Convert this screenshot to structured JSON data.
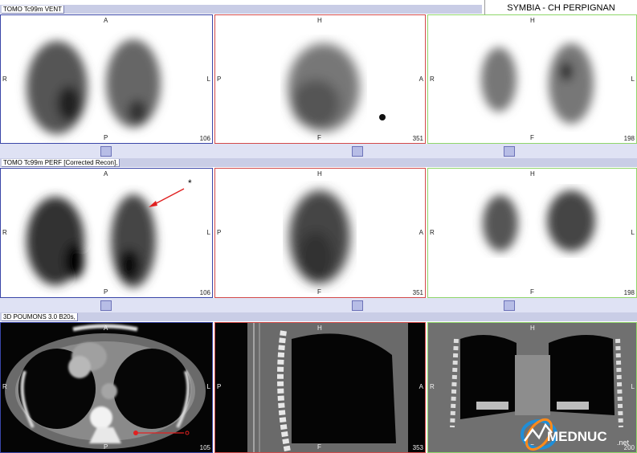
{
  "header_box": {
    "title": "SYMBIA - CH PERPIGNAN"
  },
  "rows": [
    {
      "label": "TOMO Tc99m VENT",
      "panels": [
        {
          "top": "A",
          "bottom": "P",
          "left": "R",
          "right": "L",
          "num": "106"
        },
        {
          "top": "H",
          "bottom": "F",
          "left": "P",
          "right": "A",
          "num": "351"
        },
        {
          "top": "H",
          "bottom": "F",
          "left": "R",
          "right": "L",
          "num": "198"
        }
      ]
    },
    {
      "label": "TOMO Tc99m PERF [Corrected Recon],",
      "panels": [
        {
          "top": "A",
          "bottom": "P",
          "left": "R",
          "right": "L",
          "num": "106"
        },
        {
          "top": "H",
          "bottom": "F",
          "left": "P",
          "right": "A",
          "num": "351"
        },
        {
          "top": "H",
          "bottom": "F",
          "left": "R",
          "right": "L",
          "num": "198"
        }
      ],
      "annotation": "*"
    },
    {
      "label": "3D POUMONS  3.0  B20s,",
      "panels": [
        {
          "top": "A",
          "bottom": "P",
          "left": "R",
          "right": "L",
          "num": "105"
        },
        {
          "top": "H",
          "bottom": "F",
          "left": "P",
          "right": "A",
          "num": "353"
        },
        {
          "top": "H",
          "bottom": "F",
          "left": "R",
          "right": "L",
          "num": "200"
        }
      ]
    }
  ],
  "watermark": {
    "text": "MEDNUC",
    "suffix": ".net"
  },
  "colors": {
    "panel_left": "#3a46a8",
    "panel_mid": "#d34a4a",
    "panel_right": "#8fd66a",
    "annotation": "#e02020"
  }
}
